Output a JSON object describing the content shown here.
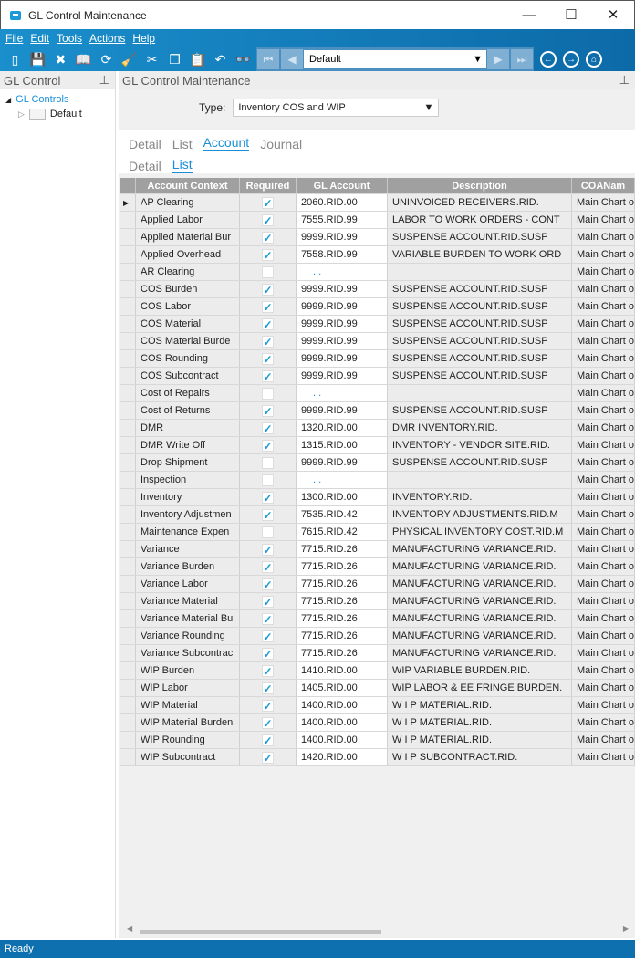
{
  "window": {
    "title": "GL Control Maintenance",
    "minimize": "—",
    "maximize": "☐",
    "close": "✕"
  },
  "menu": [
    "File",
    "Edit",
    "Tools",
    "Actions",
    "Help"
  ],
  "toolbar": {
    "icons": [
      "new-icon",
      "save-icon",
      "delete-icon",
      "open-book-icon",
      "refresh-icon",
      "clear-icon",
      "cut-icon",
      "copy-icon",
      "paste-icon",
      "undo-icon",
      "binoculars-icon"
    ],
    "glyphs": [
      "▯",
      "💾",
      "✖",
      "📖",
      "⟳",
      "🧹",
      "✂",
      "❐",
      "📋",
      "↶",
      "👓"
    ],
    "nav_value": "Default"
  },
  "left_panel": {
    "title": "GL Control",
    "tree": {
      "root": "GL Controls",
      "child": "Default"
    }
  },
  "main": {
    "title": "GL Control Maintenance",
    "type_label": "Type:",
    "type_value": "Inventory COS and WIP",
    "tabs": [
      "Detail",
      "List",
      "Account",
      "Journal"
    ],
    "active_tab": "Account",
    "subtabs": [
      "Detail",
      "List"
    ],
    "active_subtab": "List"
  },
  "grid": {
    "columns": [
      "Account Context",
      "Required",
      "GL Account",
      "Description",
      "COANam"
    ],
    "rows": [
      [
        "AP Clearing",
        true,
        "2060.RID.00",
        "UNINVOICED RECEIVERS.RID.",
        "Main Chart o"
      ],
      [
        "Applied Labor",
        true,
        "7555.RID.99",
        "LABOR TO WORK ORDERS - CONT",
        "Main Chart o"
      ],
      [
        "Applied Material Bur",
        true,
        "9999.RID.99",
        "SUSPENSE ACCOUNT.RID.SUSP",
        "Main Chart o"
      ],
      [
        "Applied Overhead",
        true,
        "7558.RID.99",
        "VARIABLE BURDEN TO WORK ORD",
        "Main Chart o"
      ],
      [
        "AR Clearing",
        false,
        ". .",
        "",
        "Main Chart o"
      ],
      [
        "COS Burden",
        true,
        "9999.RID.99",
        "SUSPENSE ACCOUNT.RID.SUSP",
        "Main Chart o"
      ],
      [
        "COS Labor",
        true,
        "9999.RID.99",
        "SUSPENSE ACCOUNT.RID.SUSP",
        "Main Chart o"
      ],
      [
        "COS Material",
        true,
        "9999.RID.99",
        "SUSPENSE ACCOUNT.RID.SUSP",
        "Main Chart o"
      ],
      [
        "COS Material Burde",
        true,
        "9999.RID.99",
        "SUSPENSE ACCOUNT.RID.SUSP",
        "Main Chart o"
      ],
      [
        "COS Rounding",
        true,
        "9999.RID.99",
        "SUSPENSE ACCOUNT.RID.SUSP",
        "Main Chart o"
      ],
      [
        "COS Subcontract",
        true,
        "9999.RID.99",
        "SUSPENSE ACCOUNT.RID.SUSP",
        "Main Chart o"
      ],
      [
        "Cost of Repairs",
        false,
        ". .",
        "",
        "Main Chart o"
      ],
      [
        "Cost of Returns",
        true,
        "9999.RID.99",
        "SUSPENSE ACCOUNT.RID.SUSP",
        "Main Chart o"
      ],
      [
        "DMR",
        true,
        "1320.RID.00",
        "DMR INVENTORY.RID.",
        "Main Chart o"
      ],
      [
        "DMR Write Off",
        true,
        "1315.RID.00",
        "INVENTORY - VENDOR SITE.RID.",
        "Main Chart o"
      ],
      [
        "Drop Shipment",
        false,
        "9999.RID.99",
        "SUSPENSE ACCOUNT.RID.SUSP",
        "Main Chart o"
      ],
      [
        "Inspection",
        false,
        ". .",
        "",
        "Main Chart o"
      ],
      [
        "Inventory",
        true,
        "1300.RID.00",
        "INVENTORY.RID.",
        "Main Chart o"
      ],
      [
        "Inventory Adjustmen",
        true,
        "7535.RID.42",
        "INVENTORY ADJUSTMENTS.RID.M",
        "Main Chart o"
      ],
      [
        "Maintenance Expen",
        false,
        "7615.RID.42",
        "PHYSICAL INVENTORY COST.RID.M",
        "Main Chart o"
      ],
      [
        "Variance",
        true,
        "7715.RID.26",
        "MANUFACTURING VARIANCE.RID.",
        "Main Chart o"
      ],
      [
        "Variance Burden",
        true,
        "7715.RID.26",
        "MANUFACTURING VARIANCE.RID.",
        "Main Chart o"
      ],
      [
        "Variance Labor",
        true,
        "7715.RID.26",
        "MANUFACTURING VARIANCE.RID.",
        "Main Chart o"
      ],
      [
        "Variance Material",
        true,
        "7715.RID.26",
        "MANUFACTURING VARIANCE.RID.",
        "Main Chart o"
      ],
      [
        "Variance Material Bu",
        true,
        "7715.RID.26",
        "MANUFACTURING VARIANCE.RID.",
        "Main Chart o"
      ],
      [
        "Variance Rounding",
        true,
        "7715.RID.26",
        "MANUFACTURING VARIANCE.RID.",
        "Main Chart o"
      ],
      [
        "Variance Subcontrac",
        true,
        "7715.RID.26",
        "MANUFACTURING VARIANCE.RID.",
        "Main Chart o"
      ],
      [
        "WIP Burden",
        true,
        "1410.RID.00",
        "WIP VARIABLE BURDEN.RID.",
        "Main Chart o"
      ],
      [
        "WIP Labor",
        true,
        "1405.RID.00",
        "WIP LABOR & EE FRINGE BURDEN.",
        "Main Chart o"
      ],
      [
        "WIP Material",
        true,
        "1400.RID.00",
        "W I P MATERIAL.RID.",
        "Main Chart o"
      ],
      [
        "WIP Material Burden",
        true,
        "1400.RID.00",
        "W I P MATERIAL.RID.",
        "Main Chart o"
      ],
      [
        "WIP Rounding",
        true,
        "1400.RID.00",
        "W I P MATERIAL.RID.",
        "Main Chart o"
      ],
      [
        "WIP Subcontract",
        true,
        "1420.RID.00",
        "W I P SUBCONTRACT.RID.",
        "Main Chart o"
      ]
    ]
  },
  "status": "Ready",
  "colors": {
    "ribbon": "#1a8fcc",
    "accent": "#1a8fd6",
    "status_bar": "#0f70b0"
  }
}
